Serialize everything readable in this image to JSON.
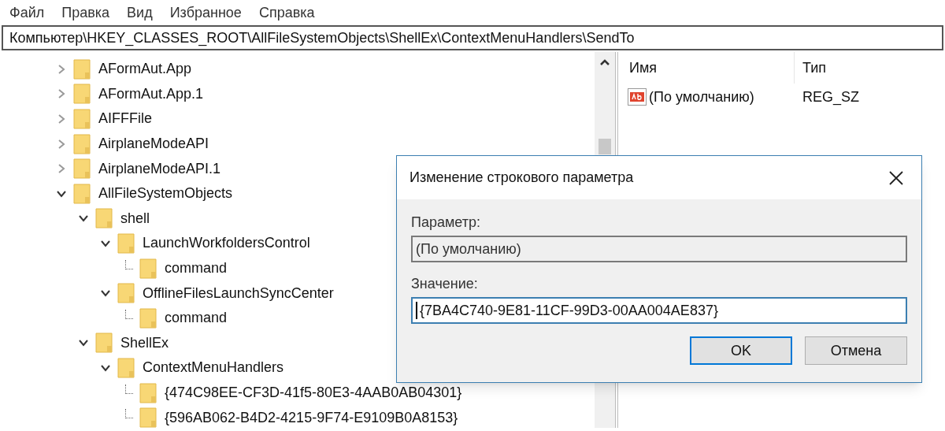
{
  "menu": [
    "Файл",
    "Правка",
    "Вид",
    "Избранное",
    "Справка"
  ],
  "address": "Компьютер\\HKEY_CLASSES_ROOT\\AllFileSystemObjects\\ShellEx\\ContextMenuHandlers\\SendTo",
  "tree": [
    {
      "label": "AFormAut.App",
      "expanded": false
    },
    {
      "label": "AFormAut.App.1",
      "expanded": false
    },
    {
      "label": "AIFFFile",
      "expanded": false
    },
    {
      "label": "AirplaneModeAPI",
      "expanded": false
    },
    {
      "label": "AirplaneModeAPI.1",
      "expanded": false
    },
    {
      "label": "AllFileSystemObjects",
      "expanded": true,
      "children": [
        {
          "label": "shell",
          "expanded": true,
          "children": [
            {
              "label": "LaunchWorkfoldersControl",
              "expanded": true,
              "children": [
                {
                  "label": "command"
                }
              ]
            },
            {
              "label": "OfflineFilesLaunchSyncCenter",
              "expanded": true,
              "children": [
                {
                  "label": "command"
                }
              ]
            }
          ]
        },
        {
          "label": "ShellEx",
          "expanded": true,
          "children": [
            {
              "label": "ContextMenuHandlers",
              "expanded": true,
              "children": [
                {
                  "label": "{474C98EE-CF3D-41f5-80E3-4AAB0AB04301}"
                },
                {
                  "label": "{596AB062-B4D2-4215-9F74-E9109B0A8153}"
                }
              ]
            }
          ]
        }
      ]
    }
  ],
  "values": {
    "columns": [
      "Имя",
      "Тип"
    ],
    "rows": [
      {
        "name": "(По умолчанию)",
        "type": "REG_SZ"
      }
    ]
  },
  "dialog": {
    "title": "Изменение строкового параметра",
    "name_label": "Параметр:",
    "name_value": "(По умолчанию)",
    "value_label": "Значение:",
    "value": "{7BA4C740-9E81-11CF-99D3-00AA004AE837}",
    "buttons": [
      {
        "label": "OK",
        "default": true
      },
      {
        "label": "Отмена",
        "default": false
      }
    ]
  }
}
